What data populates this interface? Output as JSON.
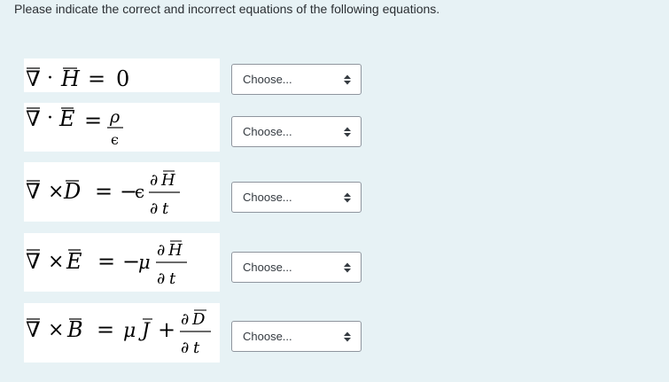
{
  "prompt": "Please indicate the correct and incorrect equations of the following equations.",
  "equations": [
    {
      "text": "∇̅ · H̅ = 0"
    },
    {
      "text": "∇̅ · E̅ = ρ/ϵ"
    },
    {
      "text": "∇̅ × D̅ = −ϵ ∂H̅/∂t"
    },
    {
      "text": "∇̅ × E̅ = −μ ∂H̅/∂t"
    },
    {
      "text": "∇̅ × B̅ = μJ̅ + ∂D̅/∂t"
    }
  ],
  "select_placeholder": "Choose...",
  "colors": {
    "background": "#e7f2f5",
    "select_border": "#8f959e"
  },
  "icons": {
    "select_arrow": "updown-caret-icon"
  }
}
